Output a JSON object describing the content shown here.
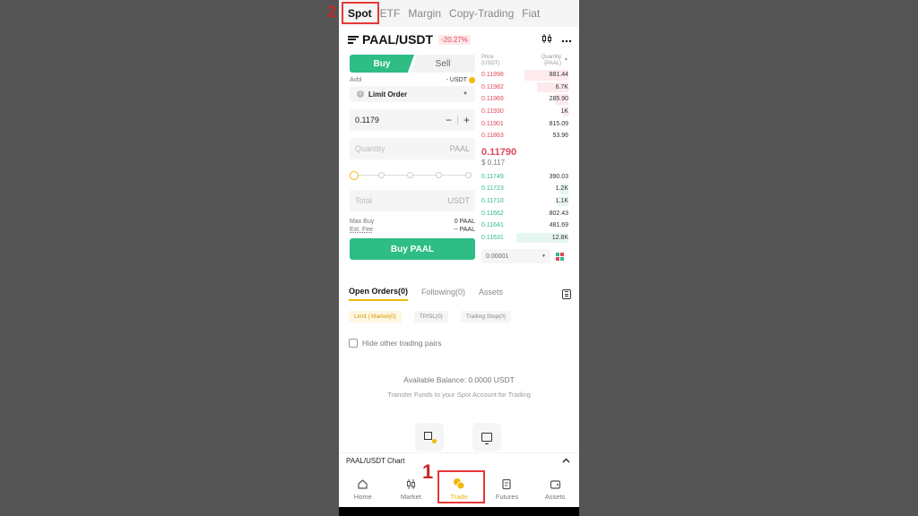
{
  "top_tabs": [
    "Spot",
    "ETF",
    "Margin",
    "Copy-Trading",
    "Fiat"
  ],
  "annotations": [
    "1",
    "2"
  ],
  "header": {
    "pair": "PAAL/USDT",
    "change": "-20.27%"
  },
  "form": {
    "buy_label": "Buy",
    "sell_label": "Sell",
    "avbl_label": "Avbl",
    "avbl_value": "- USDT",
    "order_type": "Limit Order",
    "price_value": "0.1179",
    "quantity_placeholder": "Quantity",
    "quantity_unit": "PAAL",
    "total_placeholder": "Total",
    "total_unit": "USDT",
    "max_buy_label": "Max Buy",
    "max_buy_value": "0 PAAL",
    "est_fee_label": "Est. Fee",
    "est_fee_value": "-- PAAL",
    "submit_label": "Buy PAAL"
  },
  "book": {
    "price_header": "Price\n(USDT)",
    "qty_header": "Quantity\n(PAAL)",
    "asks": [
      {
        "price": "0.11998",
        "qty": "881.44",
        "depth": 0.85
      },
      {
        "price": "0.11982",
        "qty": "6.7K",
        "depth": 0.6
      },
      {
        "price": "0.11969",
        "qty": "285.90",
        "depth": 0.25
      },
      {
        "price": "0.11930",
        "qty": "1K",
        "depth": 0.1
      },
      {
        "price": "0.11901",
        "qty": "815.09",
        "depth": 0
      },
      {
        "price": "0.11863",
        "qty": "53.96",
        "depth": 0
      }
    ],
    "mid_price": "0.11790",
    "mid_usd": "$ 0.117",
    "bids": [
      {
        "price": "0.11749",
        "qty": "390.03",
        "depth": 0
      },
      {
        "price": "0.11723",
        "qty": "1.2K",
        "depth": 0.15
      },
      {
        "price": "0.11710",
        "qty": "1.1K",
        "depth": 0.2
      },
      {
        "price": "0.11662",
        "qty": "802.43",
        "depth": 0
      },
      {
        "price": "0.11641",
        "qty": "481.69",
        "depth": 0
      },
      {
        "price": "0.11631",
        "qty": "12.8K",
        "depth": 1.0
      }
    ],
    "precision": "0.00001"
  },
  "orders": {
    "tabs": [
      "Open Orders(0)",
      "Following(0)",
      "Assets"
    ],
    "filters": [
      "Limit | Market(0)",
      "TP/SL(0)",
      "Trailing Stop(0)"
    ],
    "hide_pairs_label": "Hide other trading pairs",
    "balance_text": "Available Balance: 0.0000 USDT",
    "transfer_text": "Transfer Funds to your Spot Account for Trading"
  },
  "chart_label": "PAAL/USDT Chart",
  "nav": [
    "Home",
    "Market",
    "Trade",
    "Futures",
    "Assets"
  ],
  "colors": {
    "buy": "#2ebd85",
    "sell": "#e0485c",
    "accent": "#f0b90b",
    "annotation": "#e53935"
  }
}
